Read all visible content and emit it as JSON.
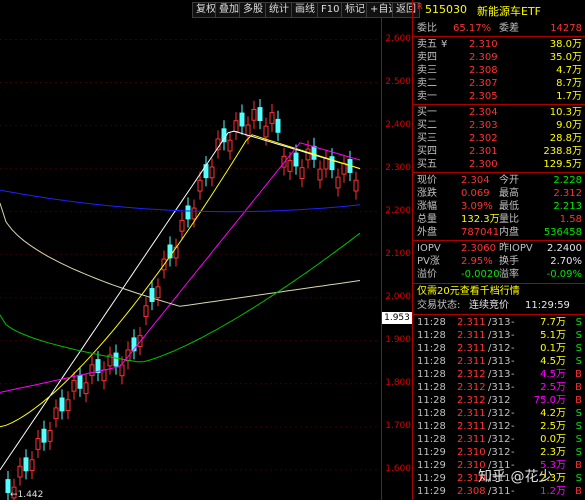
{
  "toolbar": {
    "buttons": [
      "复权",
      "叠加",
      "多股",
      "统计",
      "画线",
      "F10",
      "标记",
      "+自选",
      "返回"
    ]
  },
  "price_axis": {
    "ticks": [
      "2.600",
      "2.500",
      "2.400",
      "2.300",
      "2.200",
      "2.100",
      "2.000",
      "1.900",
      "1.800",
      "1.700",
      "1.600"
    ],
    "crosshair_value": "1.953",
    "low_label": "←1.442"
  },
  "quote": {
    "badge": "R",
    "code": "515030",
    "name": "新能源车ETF",
    "weibi_label": "委比",
    "weibi_value": "65.17%",
    "weicha_label": "委差",
    "weicha_value": "14278",
    "asks": [
      {
        "label": "卖五",
        "flag": "¥",
        "price": "2.310",
        "vol": "38.0万"
      },
      {
        "label": "卖四",
        "flag": "",
        "price": "2.309",
        "vol": "35.0万"
      },
      {
        "label": "卖三",
        "flag": "",
        "price": "2.308",
        "vol": "4.7万"
      },
      {
        "label": "卖二",
        "flag": "",
        "price": "2.307",
        "vol": "8.7万"
      },
      {
        "label": "卖一",
        "flag": "",
        "price": "2.305",
        "vol": "1.7万"
      }
    ],
    "bids": [
      {
        "label": "买一",
        "price": "2.304",
        "vol": "10.3万"
      },
      {
        "label": "买二",
        "price": "2.303",
        "vol": "9.0万"
      },
      {
        "label": "买三",
        "price": "2.302",
        "vol": "28.8万"
      },
      {
        "label": "买四",
        "price": "2.301",
        "vol": "238.8万"
      },
      {
        "label": "买五",
        "price": "2.300",
        "vol": "129.5万"
      }
    ],
    "stats": [
      {
        "l1": "现价",
        "v1": "2.304",
        "c1": "red",
        "l2": "今开",
        "v2": "2.228",
        "c2": "green"
      },
      {
        "l1": "涨跌",
        "v1": "0.069",
        "c1": "red",
        "l2": "最高",
        "v2": "2.312",
        "c2": "red"
      },
      {
        "l1": "涨幅",
        "v1": "3.09%",
        "c1": "red",
        "l2": "最低",
        "v2": "2.213",
        "c2": "green"
      },
      {
        "l1": "总量",
        "v1": "132.3万",
        "c1": "yellow",
        "l2": "量比",
        "v2": "1.58",
        "c2": "red"
      },
      {
        "l1": "外盘",
        "v1": "787041",
        "c1": "red",
        "l2": "内盘",
        "v2": "536458",
        "c2": "green"
      }
    ],
    "iopv": [
      {
        "l1": "IOPV",
        "v1": "2.3060",
        "c1": "red",
        "l2": "昨IOPV",
        "v2": "2.2400",
        "c2": "white"
      },
      {
        "l1": "PV涨",
        "v1": "2.95%",
        "c1": "red",
        "l2": "换手",
        "v2": "2.70%",
        "c2": "white"
      },
      {
        "l1": "溢价",
        "v1": "-0.0020",
        "c1": "green",
        "l2": "溢率",
        "v2": "-0.09%",
        "c2": "green"
      }
    ],
    "ad_text": "仅需20元查看千档行情",
    "status_label": "交易状态:",
    "status_value": "连续竞价",
    "status_time": "11:29:59",
    "ticks": [
      {
        "t": "11:28",
        "p": "2.311",
        "r": "/313",
        "d": "-",
        "v": "7.7万",
        "s": "S"
      },
      {
        "t": "11:28",
        "p": "2.311",
        "r": "/313",
        "d": "-",
        "v": "5.1万",
        "s": "S"
      },
      {
        "t": "11:28",
        "p": "2.311",
        "r": "/312",
        "d": "-",
        "v": "0.1万",
        "s": "S"
      },
      {
        "t": "11:28",
        "p": "2.311",
        "r": "/313",
        "d": "-",
        "v": "4.5万",
        "s": "S"
      },
      {
        "t": "11:28",
        "p": "2.312",
        "r": "/313",
        "d": "-",
        "v": "4.5万",
        "s": "B"
      },
      {
        "t": "11:28",
        "p": "2.312",
        "r": "/313",
        "d": "-",
        "v": "2.5万",
        "s": "B"
      },
      {
        "t": "11:28",
        "p": "2.312",
        "r": "/312",
        "d": "",
        "v": "75.0万",
        "s": "B"
      },
      {
        "t": "11:28",
        "p": "2.311",
        "r": "/312",
        "d": "-",
        "v": "4.2万",
        "s": "S"
      },
      {
        "t": "11:28",
        "p": "2.311",
        "r": "/312",
        "d": "-",
        "v": "2.5万",
        "s": "S"
      },
      {
        "t": "11:28",
        "p": "2.311",
        "r": "/312",
        "d": "-",
        "v": "0.0万",
        "s": "S"
      },
      {
        "t": "11:29",
        "p": "2.310",
        "r": "/312",
        "d": "-",
        "v": "2.3万",
        "s": "S"
      },
      {
        "t": "11:29",
        "p": "2.310",
        "r": "/311",
        "d": "-",
        "v": "5.3万",
        "s": "B"
      },
      {
        "t": "11:29",
        "p": "2.310",
        "r": "/311",
        "d": "-",
        "v": "2.3万",
        "s": "S"
      },
      {
        "t": "11:29",
        "p": "2.308",
        "r": "/311",
        "d": "-",
        "v": "1.2万",
        "s": "B"
      }
    ],
    "watermark": "知乎 @花少"
  }
}
